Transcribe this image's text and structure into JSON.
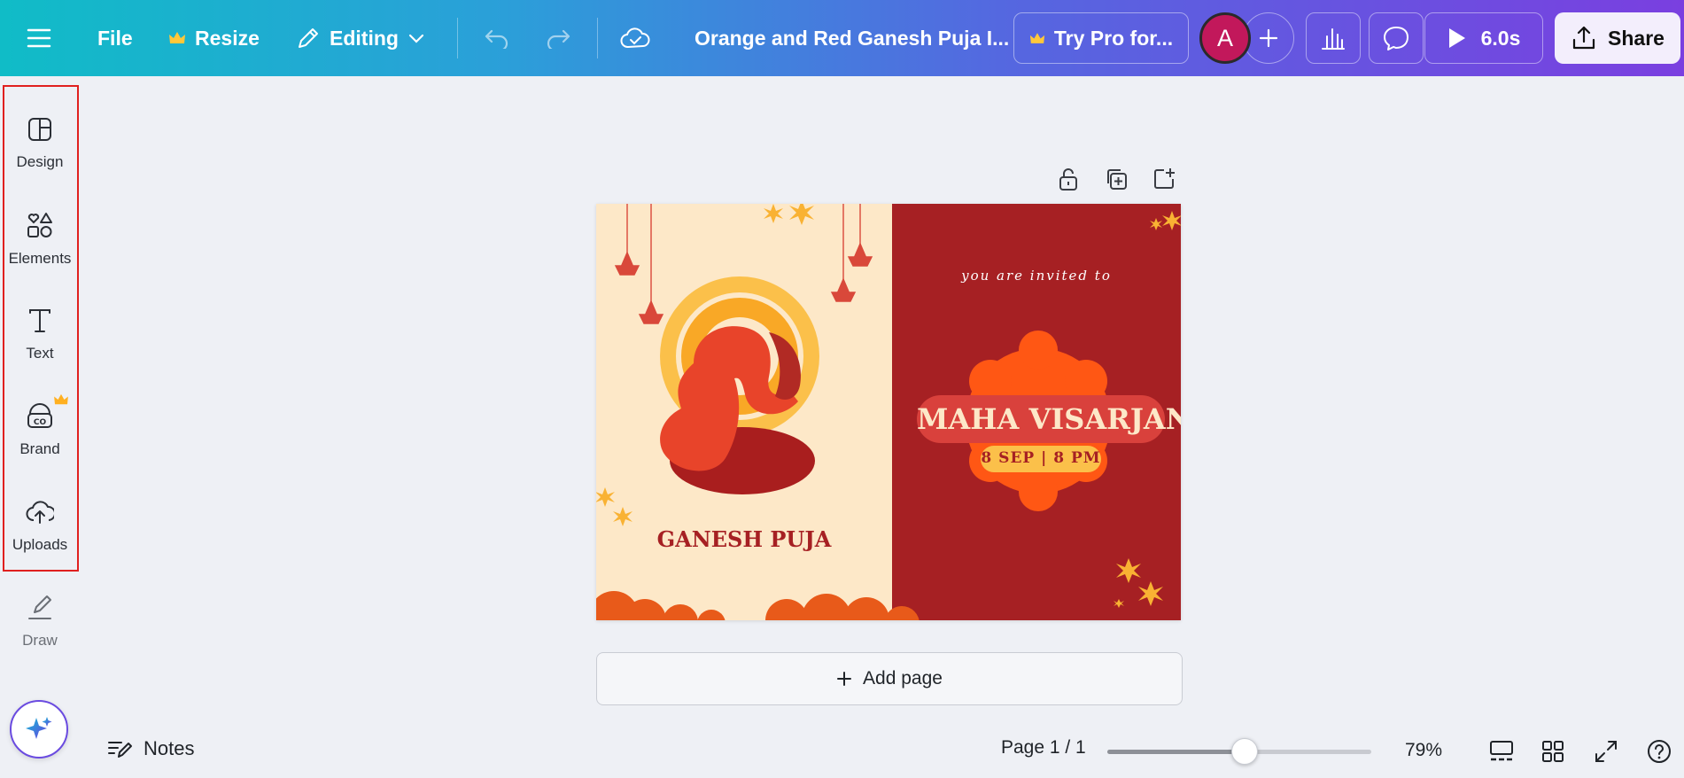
{
  "topbar": {
    "file_label": "File",
    "resize_label": "Resize",
    "editing_label": "Editing",
    "doc_title": "Orange and Red Ganesh Puja I...",
    "pro_label": "Try Pro for...",
    "avatar_initial": "A",
    "play_duration": "6.0s",
    "share_label": "Share"
  },
  "sidebar": {
    "items": [
      {
        "label": "Design",
        "icon": "design-icon"
      },
      {
        "label": "Elements",
        "icon": "elements-icon"
      },
      {
        "label": "Text",
        "icon": "text-icon"
      },
      {
        "label": "Brand",
        "icon": "brand-icon"
      },
      {
        "label": "Uploads",
        "icon": "uploads-icon"
      },
      {
        "label": "Draw",
        "icon": "draw-icon"
      }
    ]
  },
  "design": {
    "invite_text": "you are invited to",
    "event_title": "MAHA VISARJAN",
    "event_date": "8 SEP | 8 PM",
    "left_title": "GANESH PUJA"
  },
  "canvas": {
    "add_page_label": "Add page"
  },
  "bottombar": {
    "notes_label": "Notes",
    "page_info": "Page 1 / 1",
    "zoom_level": "79%",
    "zoom_fraction": 0.52
  },
  "colors": {
    "accent": "#7d2ae8",
    "cream": "#fde8c8",
    "maroon": "#a62023",
    "orange": "#ff5714",
    "selection": "#e0201f"
  }
}
